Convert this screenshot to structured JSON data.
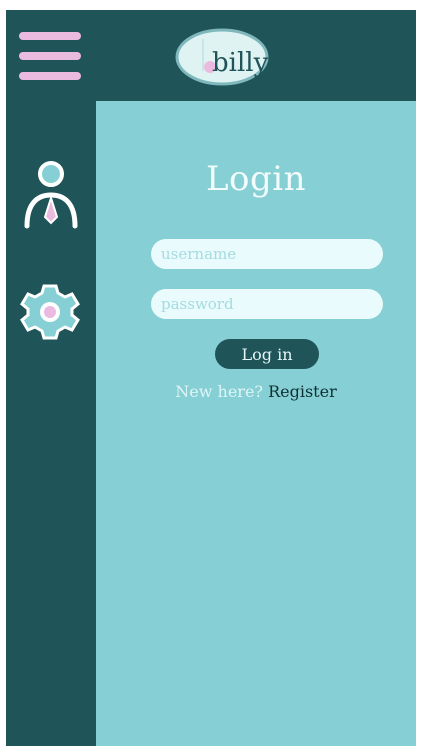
{
  "header": {
    "logo_text": "billy",
    "menu_icon": "hamburger-menu-icon"
  },
  "sidebar": {
    "items": [
      {
        "icon": "user-profile-icon"
      },
      {
        "icon": "gear-icon"
      }
    ]
  },
  "login": {
    "title": "Login",
    "username_placeholder": "username",
    "password_placeholder": "password",
    "submit_label": "Log in",
    "new_here_text": "New here?",
    "register_label": "Register"
  },
  "colors": {
    "dark_teal": "#1f5458",
    "light_teal": "#86cfd4",
    "pink": "#ebbadf",
    "input_bg": "#e9fbfc"
  }
}
